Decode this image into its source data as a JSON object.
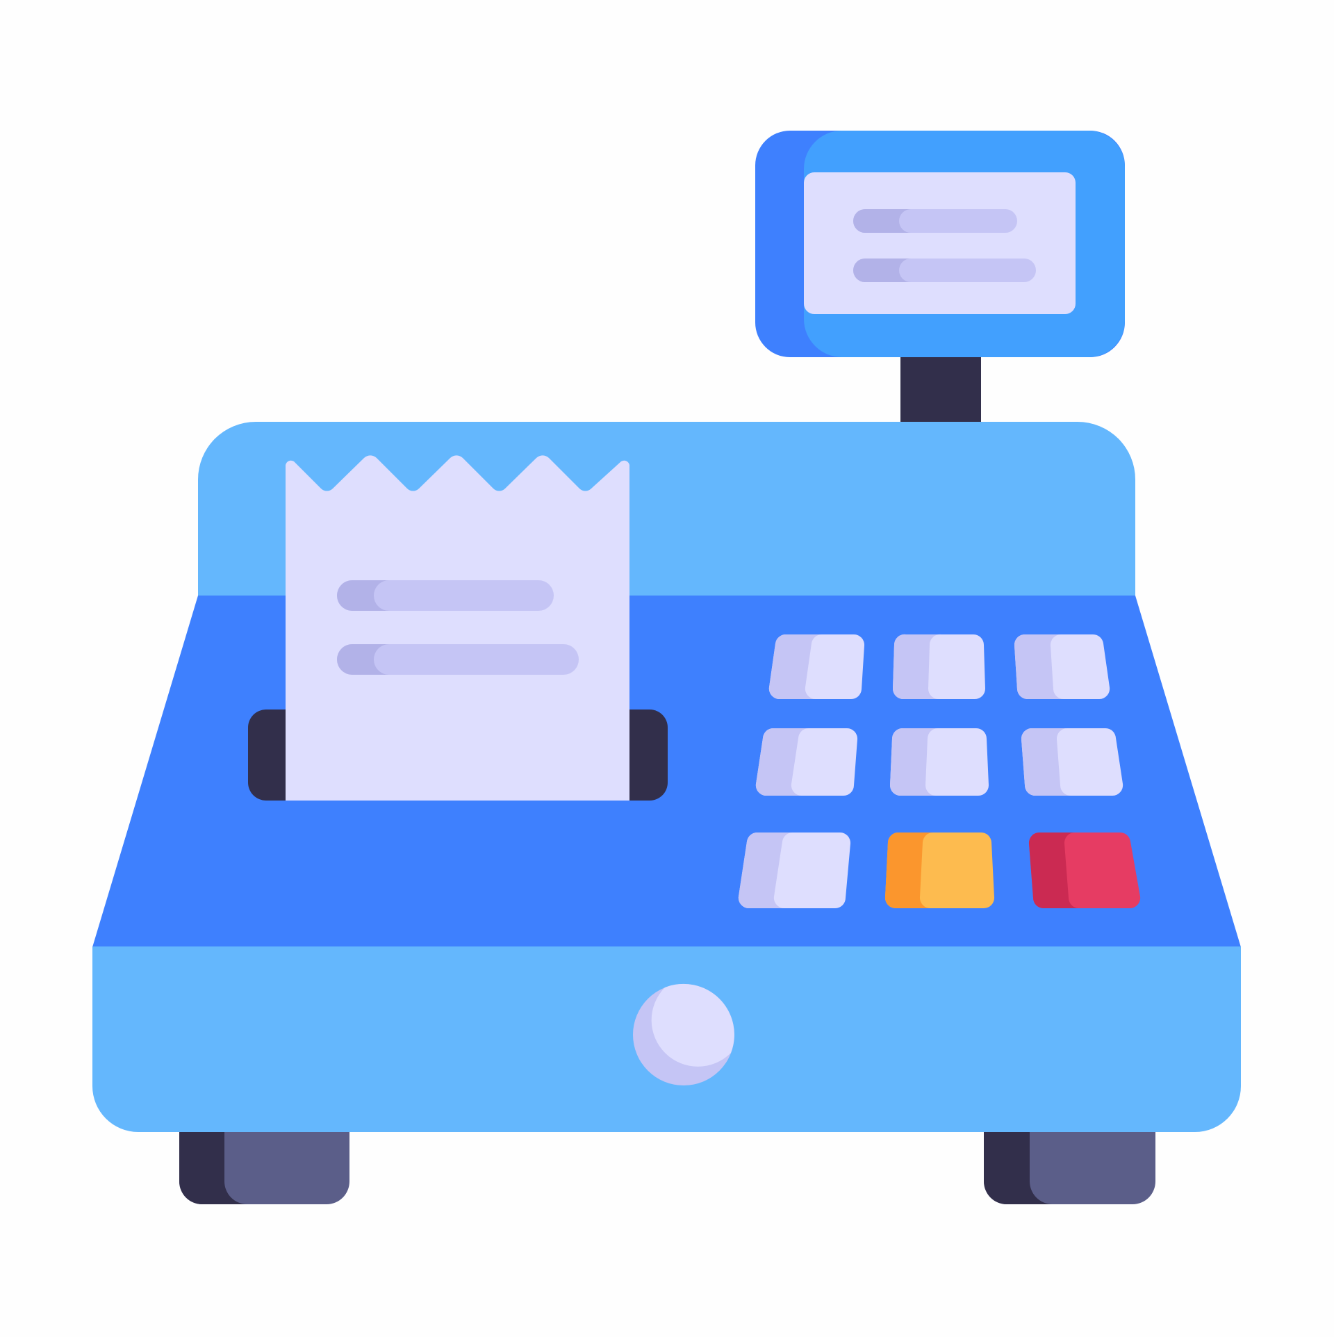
{
  "illustration": {
    "subject": "cash-register",
    "colors": {
      "background": "#fefefe",
      "body_light": "#64b7fd",
      "body_dark": "#3e80fe",
      "display_frame": "#42a0fe",
      "display_frame_shade": "#3e80fe",
      "paper": "#dedefe",
      "paper_line": "#c5c5f5",
      "paper_line_shade": "#b2b2e8",
      "slot_dark": "#322f4b",
      "foot_light": "#5b5e89",
      "key_light": "#dedefe",
      "key_shade": "#c5c5f5",
      "key_orange": "#fdbb4f",
      "key_orange_shade": "#fb962d",
      "key_red": "#e63c63",
      "key_red_shade": "#cb2a52"
    },
    "keypad": {
      "rows": 3,
      "columns": 3,
      "keys": [
        {
          "name": "key-r1-c1",
          "color": "light"
        },
        {
          "name": "key-r1-c2",
          "color": "light"
        },
        {
          "name": "key-r1-c3",
          "color": "light"
        },
        {
          "name": "key-r2-c1",
          "color": "light"
        },
        {
          "name": "key-r2-c2",
          "color": "light"
        },
        {
          "name": "key-r2-c3",
          "color": "light"
        },
        {
          "name": "key-r3-c1",
          "color": "light"
        },
        {
          "name": "key-r3-c2",
          "color": "orange"
        },
        {
          "name": "key-r3-c3",
          "color": "red"
        }
      ]
    },
    "display_lines": 2,
    "receipt_lines": 2
  }
}
